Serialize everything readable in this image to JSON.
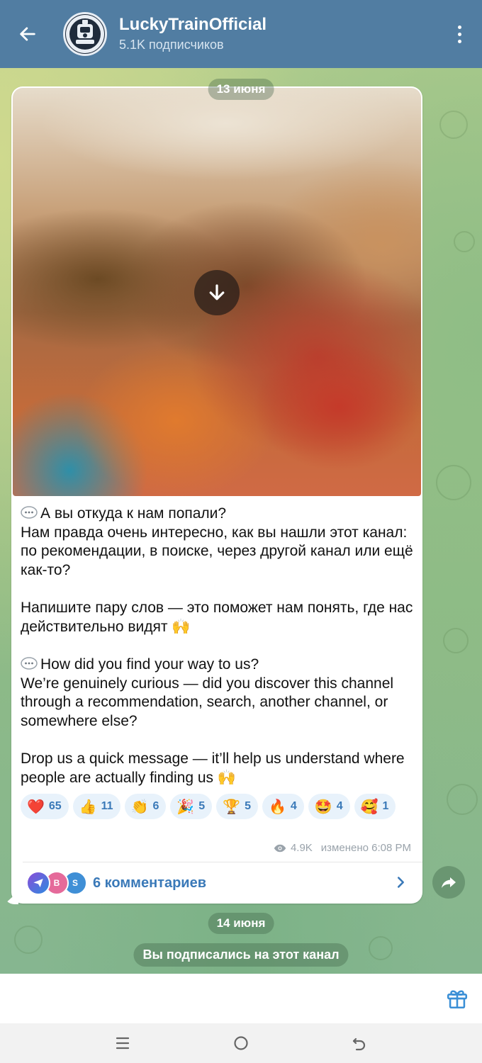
{
  "header": {
    "title": "LuckyTrainOfficial",
    "subtitle": "5.1K подписчиков",
    "back_icon": "arrow-left-icon",
    "menu_icon": "more-vertical-icon",
    "bg_color": "#517da2"
  },
  "dates": {
    "first": "13 июня",
    "second": "14 июня"
  },
  "post": {
    "media_icon": "download-icon",
    "ru_q": "А вы откуда к нам попали?",
    "ru_body": "Нам правда очень интересно, как вы нашли этот канал: по рекомендации, в поиске, через другой канал или ещё как-то?",
    "ru_call": "Напишите пару слов — это поможет нам понять, где нас действительно видят",
    "en_q": "How did you find your way to us?",
    "en_body": "We’re genuinely curious — did you discover this channel through a recommendation, search, another channel, or somewhere else?",
    "en_call": "Drop us a quick message — it’ll help us understand where people are actually finding us",
    "raise_hands_emoji": "🙌",
    "views": "4.9K",
    "edited": "изменено 6:08 PM",
    "reactions": [
      {
        "emoji": "❤️",
        "count": "65"
      },
      {
        "emoji": "👍",
        "count": "11"
      },
      {
        "emoji": "👏",
        "count": "6"
      },
      {
        "emoji": "🎉",
        "count": "5"
      },
      {
        "emoji": "🏆",
        "count": "5"
      },
      {
        "emoji": "🔥",
        "count": "4"
      },
      {
        "emoji": "🤩",
        "count": "4"
      },
      {
        "emoji": "🥰",
        "count": "1"
      }
    ],
    "comments": {
      "label": "6 комментариев",
      "avatars": [
        "",
        "B",
        "S"
      ]
    }
  },
  "service_message": "Вы подписались на этот канал",
  "accent_color": "#3a79b8"
}
